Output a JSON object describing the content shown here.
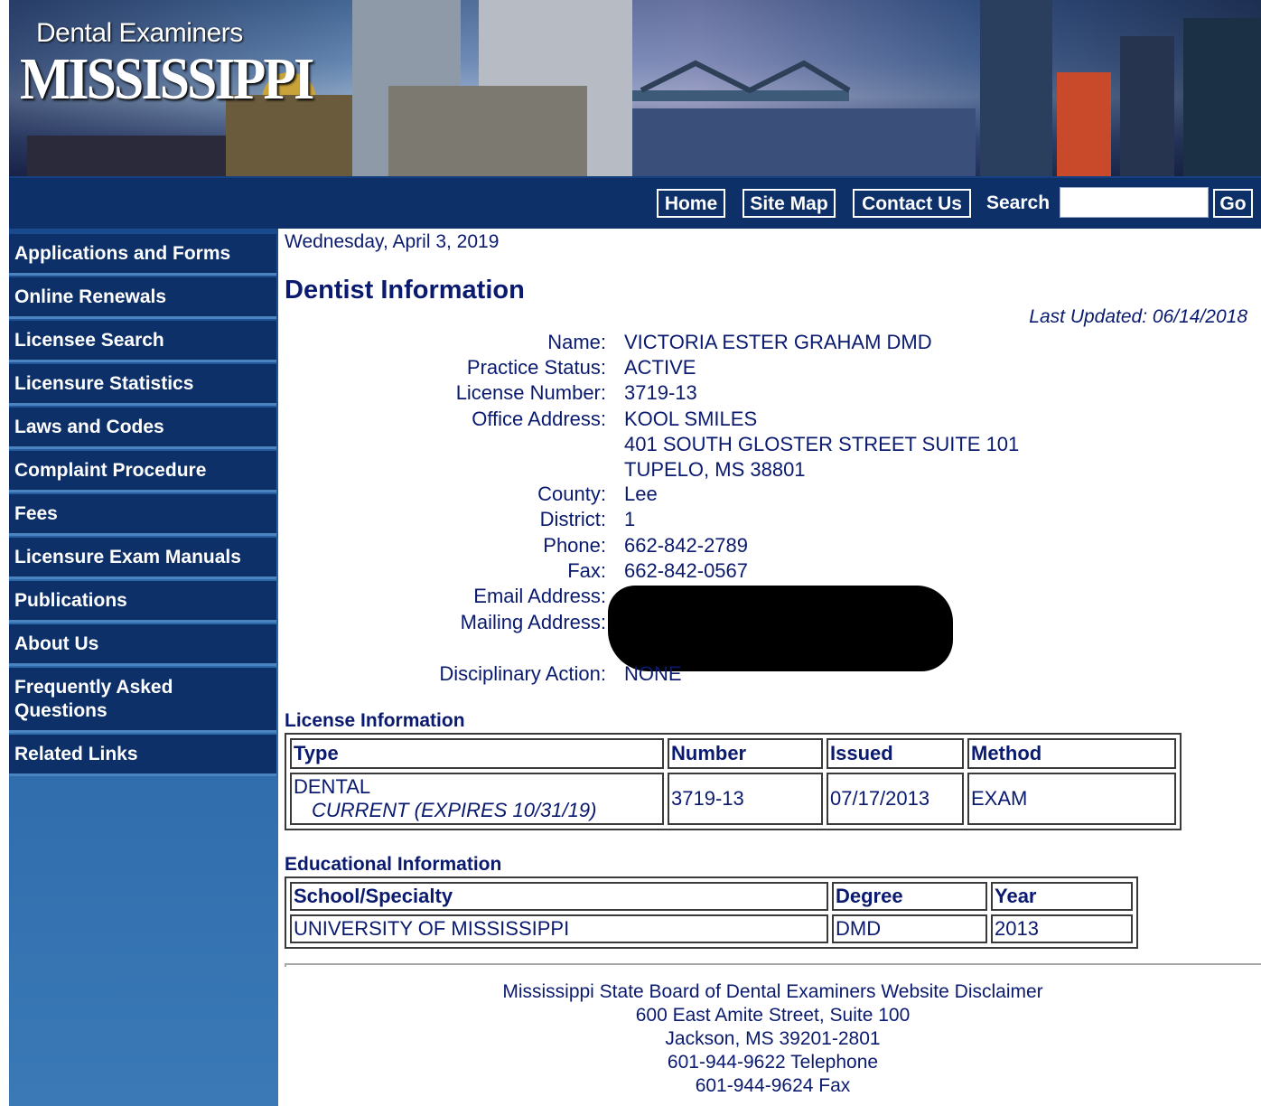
{
  "header": {
    "logo_line1": "Dental Examiners",
    "logo_line2": "MISSISSIPPI"
  },
  "nav": {
    "home": "Home",
    "site_map": "Site Map",
    "contact_us": "Contact Us",
    "search_label": "Search",
    "search_value": "",
    "go": "Go"
  },
  "sidebar": {
    "items": [
      {
        "label": "Applications and Forms"
      },
      {
        "label": "Online Renewals"
      },
      {
        "label": "Licensee Search"
      },
      {
        "label": "Licensure Statistics"
      },
      {
        "label": "Laws and Codes"
      },
      {
        "label": "Complaint Procedure"
      },
      {
        "label": "Fees"
      },
      {
        "label": "Licensure Exam Manuals"
      },
      {
        "label": "Publications"
      },
      {
        "label": "About Us"
      },
      {
        "label": "Frequently Asked Questions"
      },
      {
        "label": "Related Links"
      }
    ]
  },
  "main": {
    "date": "Wednesday, April 3, 2019",
    "title": "Dentist Information",
    "last_updated": "Last Updated: 06/14/2018",
    "fields": {
      "name_label": "Name:",
      "name": "VICTORIA ESTER GRAHAM DMD",
      "status_label": "Practice Status:",
      "status": "ACTIVE",
      "license_label": "License Number:",
      "license": "3719-13",
      "office_label": "Office Address:",
      "office_line1": "KOOL SMILES",
      "office_line2": "401 SOUTH GLOSTER STREET SUITE 101",
      "office_line3": "TUPELO, MS 38801",
      "county_label": "County:",
      "county": "Lee",
      "district_label": "District:",
      "district": "1",
      "phone_label": "Phone:",
      "phone": "662-842-2789",
      "fax_label": "Fax:",
      "fax": "662-842-0567",
      "email_label": "Email Address:",
      "mailing_label": "Mailing Address:",
      "disciplinary_label": "Disciplinary Action:",
      "disciplinary": "NONE"
    },
    "license_info": {
      "title": "License Information",
      "headers": [
        "Type",
        "Number",
        "Issued",
        "Method"
      ],
      "row": {
        "type": "DENTAL",
        "type_status": "CURRENT (EXPIRES 10/31/19)",
        "number": "3719-13",
        "issued": "07/17/2013",
        "method": "EXAM"
      }
    },
    "education_info": {
      "title": "Educational Information",
      "headers": [
        "School/Specialty",
        "Degree",
        "Year"
      ],
      "row": {
        "school": "UNIVERSITY OF MISSISSIPPI",
        "degree": "DMD",
        "year": "2013"
      }
    }
  },
  "footer": {
    "line1": "Mississippi State Board of Dental Examiners Website Disclaimer",
    "line2": "600 East Amite Street, Suite 100",
    "line3": "Jackson, MS 39201-2801",
    "line4": "601-944-9622 Telephone",
    "line5": "601-944-9624 Fax"
  }
}
